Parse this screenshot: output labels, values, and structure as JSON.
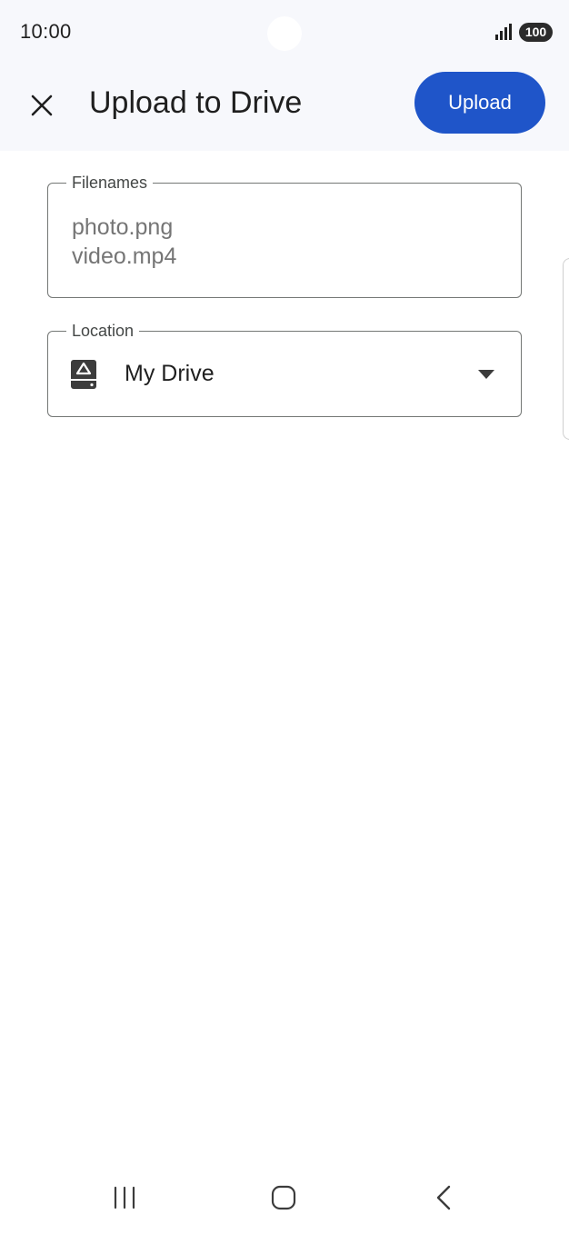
{
  "status_bar": {
    "time": "10:00",
    "battery": "100",
    "signal_icon": "signal-bars-icon"
  },
  "app_bar": {
    "close_icon": "close-icon",
    "title": "Upload to Drive",
    "upload_label": "Upload",
    "accent_color": "#1f55c9"
  },
  "filenames": {
    "label": "Filenames",
    "items": [
      "photo.png",
      "video.mp4"
    ]
  },
  "location": {
    "label": "Location",
    "value": "My Drive",
    "icon": "my-drive-icon",
    "dropdown_icon": "dropdown-arrow-icon"
  },
  "nav_bar": {
    "recents_icon": "recents-icon",
    "home_icon": "home-icon",
    "back_icon": "back-icon"
  }
}
